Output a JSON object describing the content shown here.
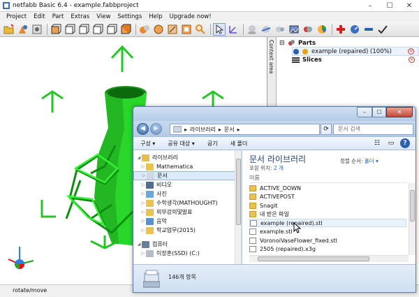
{
  "app": {
    "title": "netfabb Basic 6.4 - example.fabbproject",
    "window_buttons": [
      "–",
      "☐",
      "✕"
    ]
  },
  "menu": [
    "Project",
    "Edit",
    "Part",
    "Extras",
    "View",
    "Settings",
    "Help",
    "Upgrade now!"
  ],
  "context_area": {
    "label": "Context area"
  },
  "parts_panel": {
    "parts_label": "Parts",
    "part_name": "example (repaired) (100%)",
    "slices_label": "Slices"
  },
  "statusbar": {
    "mode": "rotate/move"
  },
  "explorer": {
    "address": [
      "라이브러리",
      "문서"
    ],
    "search_placeholder": "문서 검색",
    "commands": [
      "구성 ▾",
      "공유 대상 ▾",
      "굽기",
      "새 폴더"
    ],
    "nav": [
      {
        "label": "라이브러리",
        "icon_color": "#e3c04e",
        "level": 0
      },
      {
        "label": "Mathematica",
        "icon_color": "#e9c34d",
        "level": 1
      },
      {
        "label": "문서",
        "icon_color": "#cfd9e4",
        "level": 1,
        "selected": true
      },
      {
        "label": "비디오",
        "icon_color": "#4f6e91",
        "level": 1
      },
      {
        "label": "사진",
        "icon_color": "#6fa6d8",
        "level": 1
      },
      {
        "label": "수학생각(MATHOUGHT)",
        "icon_color": "#e9c34d",
        "level": 1
      },
      {
        "label": "외부강의및발표",
        "icon_color": "#e9c34d",
        "level": 1
      },
      {
        "label": "음악",
        "icon_color": "#5a8fd0",
        "level": 1
      },
      {
        "label": "학교업무(2015)",
        "icon_color": "#e9c34d",
        "level": 1
      },
      {
        "label": "컴퓨터",
        "icon_color": "#6a7f99",
        "level": 0
      },
      {
        "label": "이장훈(SSD) (C:)",
        "icon_color": "#b5bcc6",
        "level": 1
      }
    ],
    "library_title": "문서 라이브러리",
    "library_sub_prefix": "포함 위치:",
    "library_sub_count": "2 개",
    "arrange_label": "정렬 순서:",
    "arrange_value": "폴더 ▾",
    "column_name": "이름",
    "files": [
      {
        "name": "ACTIVE_DOWN",
        "type": "folder"
      },
      {
        "name": "ACTIVEPOST",
        "type": "folder"
      },
      {
        "name": "Snagit",
        "type": "folder"
      },
      {
        "name": "내 받은 파일",
        "type": "folder"
      },
      {
        "name": "example (repaired).stl",
        "type": "doc",
        "selected": true
      },
      {
        "name": "example.stl",
        "type": "doc"
      },
      {
        "name": "VoronoiVaseFlower_fixed.stl",
        "type": "doc"
      },
      {
        "name": "2505 (repaired).x3g",
        "type": "doc"
      }
    ],
    "status_count": "146개 항목"
  }
}
